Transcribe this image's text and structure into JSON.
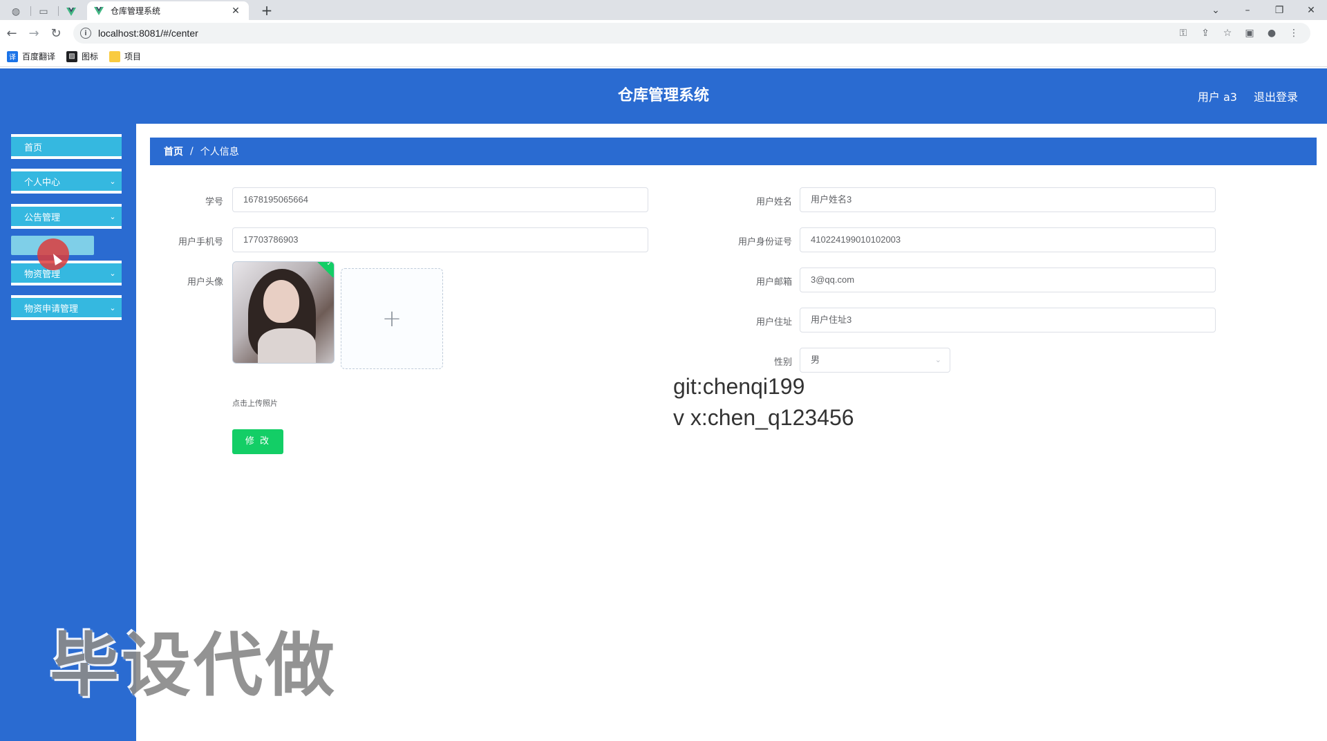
{
  "browser": {
    "tab_title": "仓库管理系统",
    "url": "localhost:8081/#/center",
    "bookmarks": [
      {
        "label": "百度翻译",
        "icon": "translate-icon",
        "color": "#1a73e8"
      },
      {
        "label": "图标",
        "icon": "image-icon",
        "color": "#202124"
      },
      {
        "label": "项目",
        "icon": "folder-icon",
        "color": "#f9cb40"
      }
    ],
    "window_controls": {
      "tabs_menu": "⌄",
      "minimize": "–",
      "restore": "❐",
      "close": "✕"
    }
  },
  "header": {
    "title": "仓库管理系统",
    "user_label": "用户 a3",
    "logout_label": "退出登录"
  },
  "sidebar": {
    "items": [
      {
        "label": "首页",
        "has_arrow": false
      },
      {
        "label": "个人中心",
        "has_arrow": true
      },
      {
        "label": "公告管理",
        "has_arrow": true
      },
      {
        "label": "物资管理",
        "has_arrow": true
      },
      {
        "label": "物资申请管理",
        "has_arrow": true
      }
    ]
  },
  "breadcrumb": {
    "home": "首页",
    "separator": "/",
    "current": "个人信息"
  },
  "form": {
    "student_id": {
      "label": "学号",
      "value": "1678195065664"
    },
    "phone": {
      "label": "用户手机号",
      "value": "17703786903"
    },
    "avatar": {
      "label": "用户头像",
      "upload_tip": "点击上传照片"
    },
    "name": {
      "label": "用户姓名",
      "value": "用户姓名3"
    },
    "id_card": {
      "label": "用户身份证号",
      "value": "410224199010102003"
    },
    "email": {
      "label": "用户邮箱",
      "value": "3@qq.com"
    },
    "address": {
      "label": "用户住址",
      "value": "用户住址3"
    },
    "gender": {
      "label": "性别",
      "value": "男"
    },
    "submit_label": "修 改"
  },
  "overlay": {
    "git": "git:chenqi199",
    "vx": "v x:chen_q123456",
    "watermark": "毕设代做"
  },
  "colors": {
    "primary": "#2a6bd1",
    "menu": "#35b8e0",
    "success": "#13ce66"
  }
}
